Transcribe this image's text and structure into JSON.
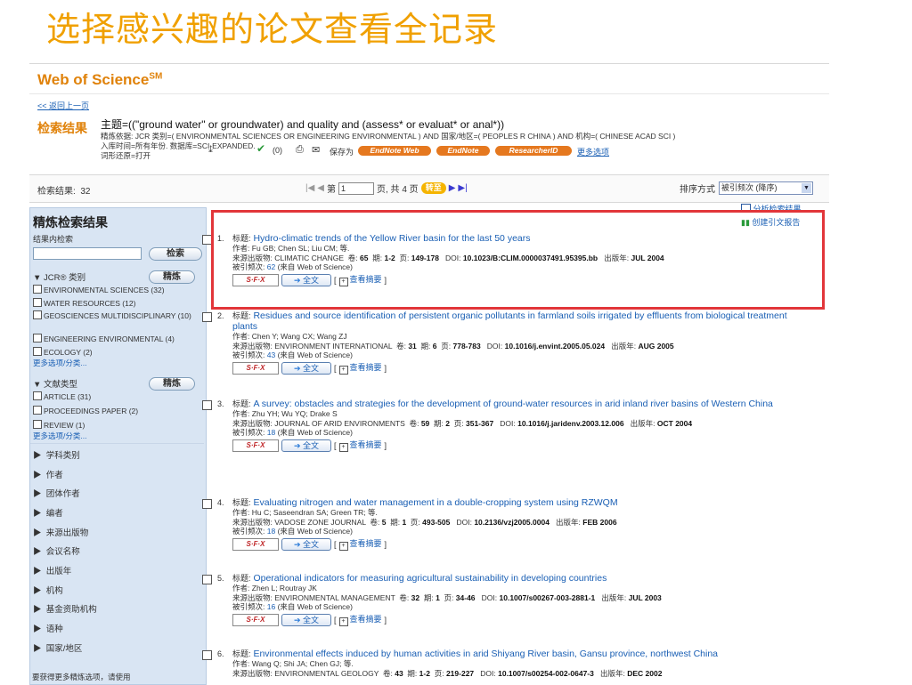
{
  "slide": {
    "title": "选择感兴趣的论文查看全记录"
  },
  "header": {
    "brand": "Web of Science",
    "brand_sup": "SM",
    "back_link": "<< 返回上一页"
  },
  "query": {
    "label": "检索结果",
    "main": "主题=((\"ground water\" or groundwater) and quality and (assess* or evaluat* or anal*))",
    "line2": "精炼依据: JCR 类别=( ENVIRONMENTAL SCIENCES OR ENGINEERING ENVIRONMENTAL ) AND 国家/地区=( PEOPLES R CHINA ) AND 机构=( CHINESE ACAD SCI )",
    "line3": "入库时间=所有年份. 数据库=SCI-EXPANDED.",
    "line4": "词形还原=打开"
  },
  "bar": {
    "count_label": "检索结果:",
    "count": "32",
    "page_label": "第",
    "page_value": "1",
    "page_suffix": "页,  共 4 页",
    "go": "转至",
    "sort_label": "排序方式",
    "sort_value": "被引频次 (降序)"
  },
  "sidebar": {
    "title": "精炼检索结果",
    "within": "结果内检索",
    "search_btn": "检索",
    "refine_btn": "精炼",
    "sec1": "JCR® 类别",
    "sec1_opts": [
      "ENVIRONMENTAL SCIENCES (32)",
      "WATER RESOURCES (12)",
      "GEOSCIENCES MULTIDISCIPLINARY (10)",
      "ENGINEERING ENVIRONMENTAL (4)",
      "ECOLOGY (2)"
    ],
    "more": "更多选项/分类...",
    "sec2": "文献类型",
    "sec2_opts": [
      "ARTICLE (31)",
      "PROCEEDINGS PAPER (2)",
      "REVIEW (1)"
    ],
    "items": [
      "学科类别",
      "作者",
      "团体作者",
      "编者",
      "来源出版物",
      "会议名称",
      "出版年",
      "机构",
      "基金资助机构",
      "语种",
      "国家/地区"
    ],
    "note": "要获得更多精炼选项，请使用"
  },
  "toolbar": {
    "count": "(0)",
    "save_as": "保存为",
    "endnote_web": "EndNote Web",
    "endnote": "EndNote",
    "researcherid": "ResearcherID",
    "more": "更多选项",
    "analyze": "分析检索结果",
    "citation_report": "创建引文报告"
  },
  "labels": {
    "title": "标题:",
    "authors": "作者:",
    "source": "来源出版物:",
    "vol": "卷:",
    "issue": "期:",
    "pages": "页:",
    "doi": "DOI:",
    "year": "出版年:",
    "cited": "被引频次:",
    "cited_suffix": "(来自 Web of Science)",
    "sfx": "S·F·X",
    "fulltext": "全文",
    "abstract": "查看摘要"
  },
  "records": [
    {
      "n": "1.",
      "title": "Hydro-climatic trends of the Yellow River basin for the last 50 years",
      "authors": "Fu GB; Chen SL; Liu CM; 等.",
      "source": "CLIMATIC CHANGE",
      "vol": "65",
      "issue": "1-2",
      "pages": "149-178",
      "doi": "10.1023/B:CLIM.0000037491.95395.bb",
      "year": "JUL 2004",
      "cited": "62"
    },
    {
      "n": "2.",
      "title": "Residues and source identification of persistent organic pollutants in farmland soils irrigated by effluents from biological treatment plants",
      "authors": "Chen Y; Wang CX; Wang ZJ",
      "source": "ENVIRONMENT INTERNATIONAL",
      "vol": "31",
      "issue": "6",
      "pages": "778-783",
      "doi": "10.1016/j.envint.2005.05.024",
      "year": "AUG 2005",
      "cited": "43"
    },
    {
      "n": "3.",
      "title": "A survey: obstacles and strategies for the development of ground-water resources in arid inland river basins of Western China",
      "authors": "Zhu YH; Wu YQ; Drake S",
      "source": "JOURNAL OF ARID ENVIRONMENTS",
      "vol": "59",
      "issue": "2",
      "pages": "351-367",
      "doi": "10.1016/j.jaridenv.2003.12.006",
      "year": "OCT 2004",
      "cited": "18"
    },
    {
      "n": "4.",
      "title": "Evaluating nitrogen and water management in a double-cropping system using RZWQM",
      "authors": "Hu C; Saseendran SA; Green TR; 等.",
      "source": "VADOSE ZONE JOURNAL",
      "vol": "5",
      "issue": "1",
      "pages": "493-505",
      "doi": "10.2136/vzj2005.0004",
      "year": "FEB 2006",
      "cited": "18"
    },
    {
      "n": "5.",
      "title": "Operational indicators for measuring agricultural sustainability in developing countries",
      "authors": "Zhen L; Routray JK",
      "source": "ENVIRONMENTAL MANAGEMENT",
      "vol": "32",
      "issue": "1",
      "pages": "34-46",
      "doi": "10.1007/s00267-003-2881-1",
      "year": "JUL 2003",
      "cited": "16"
    },
    {
      "n": "6.",
      "title": "Environmental effects induced by human activities in arid Shiyang River basin, Gansu province, northwest China",
      "authors": "Wang Q; Shi JA; Chen GJ; 等.",
      "source": "ENVIRONMENTAL GEOLOGY",
      "vol": "43",
      "issue": "1-2",
      "pages": "219-227",
      "doi": "10.1007/s00254-002-0647-3",
      "year": "DEC 2002",
      "cited": ""
    }
  ]
}
